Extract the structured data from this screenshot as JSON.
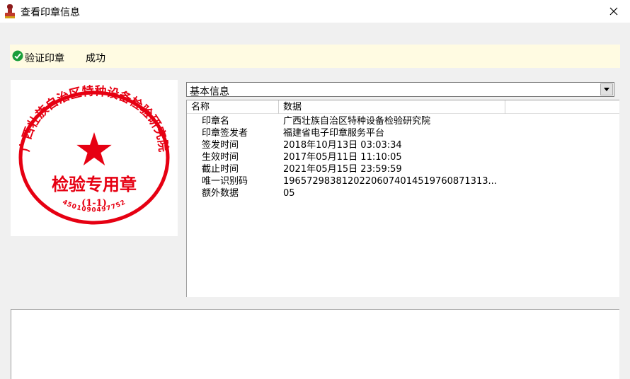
{
  "window": {
    "title": "查看印章信息",
    "close_glyph": "✕"
  },
  "verify": {
    "label": "验证印章",
    "status": "成功"
  },
  "seal": {
    "org_text": "广西壮族自治区特种设备检验研究院",
    "center_text": "检验专用章",
    "sub_text": "(1-1)",
    "serial": "4501090497752",
    "color": "#e60012"
  },
  "info_select": {
    "selected": "基本信息"
  },
  "table": {
    "columns": [
      "名称",
      "数据"
    ],
    "rows": [
      {
        "name": "印章名",
        "value": "广西壮族自治区特种设备检验研究院"
      },
      {
        "name": "印章签发者",
        "value": "福建省电子印章服务平台"
      },
      {
        "name": "签发时间",
        "value": "2018年10月13日 03:03:34"
      },
      {
        "name": "生效时间",
        "value": "2017年05月11日 11:10:05"
      },
      {
        "name": "截止时间",
        "value": "2021年05月15日 23:59:59"
      },
      {
        "name": "唯一识别码",
        "value": "196572983812022060740145197608713​13..."
      },
      {
        "name": "额外数据",
        "value": "05"
      }
    ]
  }
}
